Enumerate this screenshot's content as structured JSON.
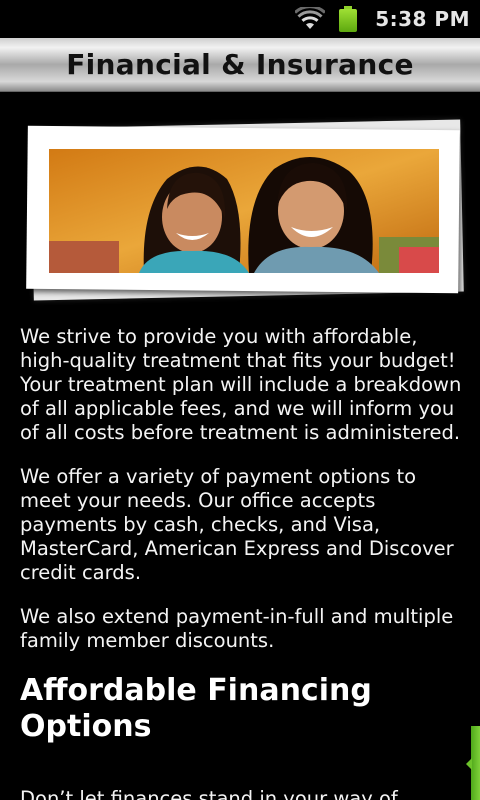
{
  "status_bar": {
    "time": "5:38 PM",
    "icons": [
      "wifi-icon",
      "battery-icon"
    ],
    "battery_color": "#8fd12a"
  },
  "header": {
    "title": "Financial & Insurance"
  },
  "hero_image": {
    "description": "Photo of a smiling girl and woman"
  },
  "content": {
    "paragraphs": [
      "We strive to provide you with affordable, high-quality treatment that fits your budget! Your treatment plan will include a breakdown of all applicable fees, and we will inform you of all costs before treatment is administered.",
      "We offer a variety of payment options to meet your needs. Our office accepts payments by cash, checks, and Visa, MasterCard, American Express and Discover credit cards.",
      "We also extend payment-in-full and multiple family member discounts."
    ],
    "section_heading": "Affordable Financing Options",
    "section_paragraph": "Don’t let finances stand in your way of"
  },
  "colors": {
    "background": "#000000",
    "accent_tab": "#6cc22a"
  }
}
